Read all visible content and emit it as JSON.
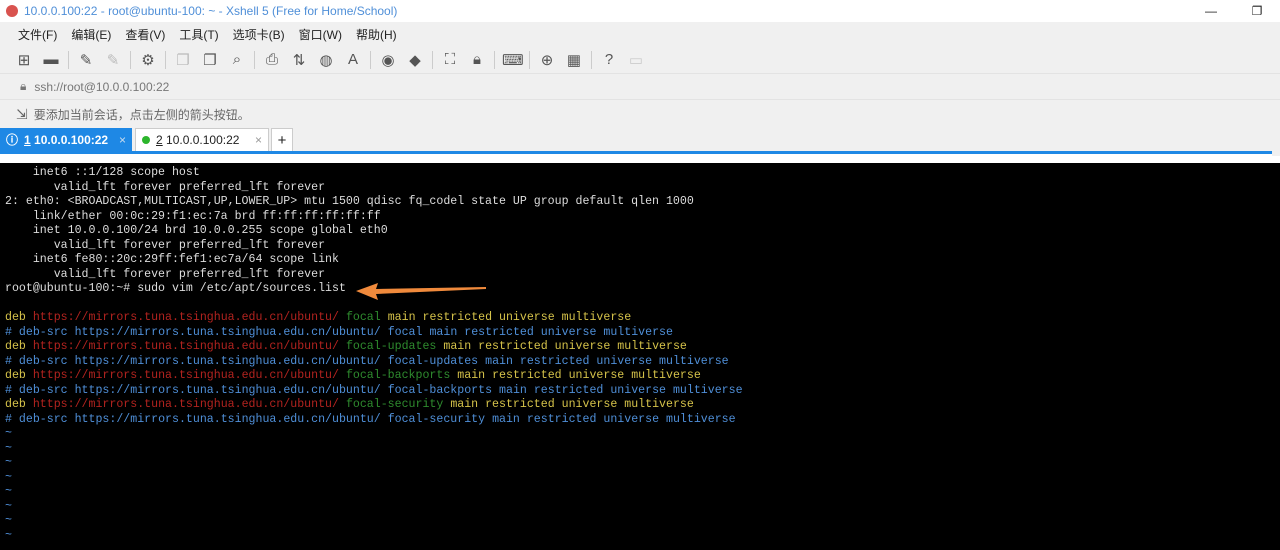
{
  "window": {
    "title": "10.0.0.100:22 - root@ubuntu-100: ~ - Xshell 5 (Free for Home/School)",
    "minimize": "—",
    "restore": "❐"
  },
  "menu": [
    "文件(F)",
    "编辑(E)",
    "查看(V)",
    "工具(T)",
    "选项卡(B)",
    "窗口(W)",
    "帮助(H)"
  ],
  "address": "ssh://root@10.0.0.100:22",
  "hint": "要添加当前会话，点击左侧的箭头按钮。",
  "tabs": [
    {
      "num": "1",
      "label": "10.0.0.100:22",
      "close": "×"
    },
    {
      "num": "2",
      "label": "10.0.0.100:22",
      "close": "×"
    }
  ],
  "new_tab": "+",
  "terminal": {
    "lines": [
      "    inet6 ::1/128 scope host",
      "       valid_lft forever preferred_lft forever",
      "2: eth0: <BROADCAST,MULTICAST,UP,LOWER_UP> mtu 1500 qdisc fq_codel state UP group default qlen 1000",
      "    link/ether 00:0c:29:f1:ec:7a brd ff:ff:ff:ff:ff:ff",
      "    inet 10.0.0.100/24 brd 10.0.0.255 scope global eth0",
      "       valid_lft forever preferred_lft forever",
      "    inet6 fe80::20c:29ff:fef1:ec7a/64 scope link",
      "       valid_lft forever preferred_lft forever",
      "root@ubuntu-100:~# sudo vim /etc/apt/sources.list"
    ],
    "sources": [
      {
        "kind": "deb",
        "url": "https://mirrors.tuna.tsinghua.edu.cn/ubuntu/",
        "suite": "focal",
        "comps": "main restricted universe multiverse"
      },
      {
        "kind": "# deb-src",
        "url": "https://mirrors.tuna.tsinghua.edu.cn/ubuntu/",
        "suite": "focal",
        "comps": "main restricted universe multiverse"
      },
      {
        "kind": "deb",
        "url": "https://mirrors.tuna.tsinghua.edu.cn/ubuntu/",
        "suite": "focal-updates",
        "comps": "main restricted universe multiverse"
      },
      {
        "kind": "# deb-src",
        "url": "https://mirrors.tuna.tsinghua.edu.cn/ubuntu/",
        "suite": "focal-updates",
        "comps": "main restricted universe multiverse"
      },
      {
        "kind": "deb",
        "url": "https://mirrors.tuna.tsinghua.edu.cn/ubuntu/",
        "suite": "focal-backports",
        "comps": "main restricted universe multiverse"
      },
      {
        "kind": "# deb-src",
        "url": "https://mirrors.tuna.tsinghua.edu.cn/ubuntu/",
        "suite": "focal-backports",
        "comps": "main restricted universe multiverse"
      },
      {
        "kind": "deb",
        "url": "https://mirrors.tuna.tsinghua.edu.cn/ubuntu/",
        "suite": "focal-security",
        "comps": "main restricted universe multiverse"
      },
      {
        "kind": "# deb-src",
        "url": "https://mirrors.tuna.tsinghua.edu.cn/ubuntu/",
        "suite": "focal-security",
        "comps": "main restricted universe multiverse"
      }
    ],
    "tilde": "~"
  },
  "colors": {
    "accent": "#1e88e5",
    "arrow": "#f08a3c"
  }
}
